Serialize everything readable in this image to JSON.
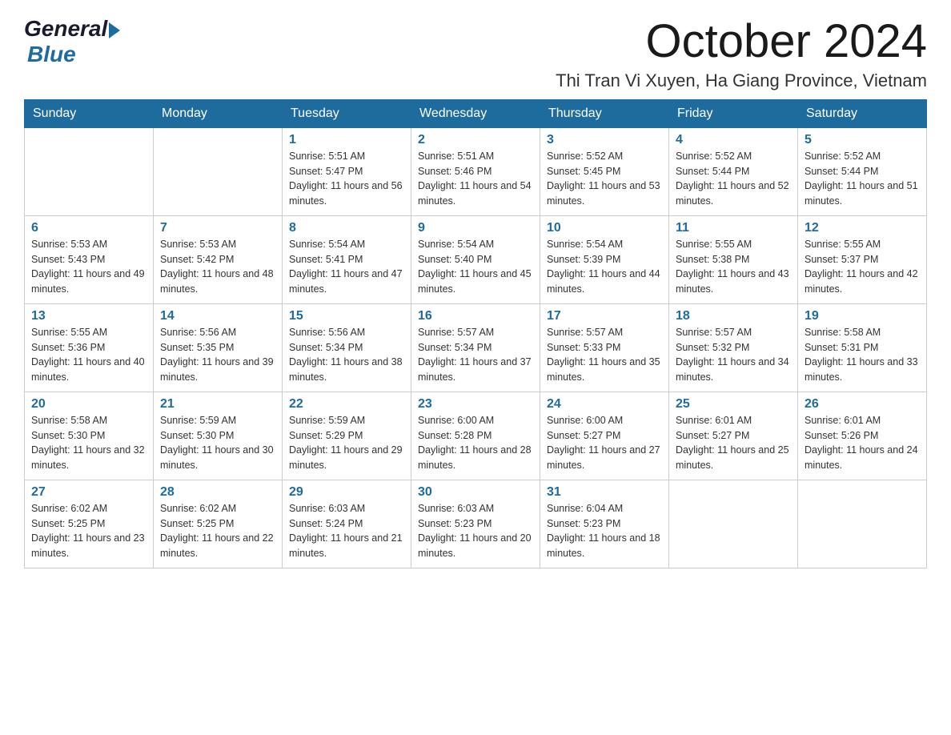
{
  "header": {
    "logo": {
      "general": "General",
      "blue": "Blue"
    },
    "month_title": "October 2024",
    "location": "Thi Tran Vi Xuyen, Ha Giang Province, Vietnam"
  },
  "days_of_week": [
    "Sunday",
    "Monday",
    "Tuesday",
    "Wednesday",
    "Thursday",
    "Friday",
    "Saturday"
  ],
  "weeks": [
    [
      {
        "day": "",
        "sunrise": "",
        "sunset": "",
        "daylight": ""
      },
      {
        "day": "",
        "sunrise": "",
        "sunset": "",
        "daylight": ""
      },
      {
        "day": "1",
        "sunrise": "Sunrise: 5:51 AM",
        "sunset": "Sunset: 5:47 PM",
        "daylight": "Daylight: 11 hours and 56 minutes."
      },
      {
        "day": "2",
        "sunrise": "Sunrise: 5:51 AM",
        "sunset": "Sunset: 5:46 PM",
        "daylight": "Daylight: 11 hours and 54 minutes."
      },
      {
        "day": "3",
        "sunrise": "Sunrise: 5:52 AM",
        "sunset": "Sunset: 5:45 PM",
        "daylight": "Daylight: 11 hours and 53 minutes."
      },
      {
        "day": "4",
        "sunrise": "Sunrise: 5:52 AM",
        "sunset": "Sunset: 5:44 PM",
        "daylight": "Daylight: 11 hours and 52 minutes."
      },
      {
        "day": "5",
        "sunrise": "Sunrise: 5:52 AM",
        "sunset": "Sunset: 5:44 PM",
        "daylight": "Daylight: 11 hours and 51 minutes."
      }
    ],
    [
      {
        "day": "6",
        "sunrise": "Sunrise: 5:53 AM",
        "sunset": "Sunset: 5:43 PM",
        "daylight": "Daylight: 11 hours and 49 minutes."
      },
      {
        "day": "7",
        "sunrise": "Sunrise: 5:53 AM",
        "sunset": "Sunset: 5:42 PM",
        "daylight": "Daylight: 11 hours and 48 minutes."
      },
      {
        "day": "8",
        "sunrise": "Sunrise: 5:54 AM",
        "sunset": "Sunset: 5:41 PM",
        "daylight": "Daylight: 11 hours and 47 minutes."
      },
      {
        "day": "9",
        "sunrise": "Sunrise: 5:54 AM",
        "sunset": "Sunset: 5:40 PM",
        "daylight": "Daylight: 11 hours and 45 minutes."
      },
      {
        "day": "10",
        "sunrise": "Sunrise: 5:54 AM",
        "sunset": "Sunset: 5:39 PM",
        "daylight": "Daylight: 11 hours and 44 minutes."
      },
      {
        "day": "11",
        "sunrise": "Sunrise: 5:55 AM",
        "sunset": "Sunset: 5:38 PM",
        "daylight": "Daylight: 11 hours and 43 minutes."
      },
      {
        "day": "12",
        "sunrise": "Sunrise: 5:55 AM",
        "sunset": "Sunset: 5:37 PM",
        "daylight": "Daylight: 11 hours and 42 minutes."
      }
    ],
    [
      {
        "day": "13",
        "sunrise": "Sunrise: 5:55 AM",
        "sunset": "Sunset: 5:36 PM",
        "daylight": "Daylight: 11 hours and 40 minutes."
      },
      {
        "day": "14",
        "sunrise": "Sunrise: 5:56 AM",
        "sunset": "Sunset: 5:35 PM",
        "daylight": "Daylight: 11 hours and 39 minutes."
      },
      {
        "day": "15",
        "sunrise": "Sunrise: 5:56 AM",
        "sunset": "Sunset: 5:34 PM",
        "daylight": "Daylight: 11 hours and 38 minutes."
      },
      {
        "day": "16",
        "sunrise": "Sunrise: 5:57 AM",
        "sunset": "Sunset: 5:34 PM",
        "daylight": "Daylight: 11 hours and 37 minutes."
      },
      {
        "day": "17",
        "sunrise": "Sunrise: 5:57 AM",
        "sunset": "Sunset: 5:33 PM",
        "daylight": "Daylight: 11 hours and 35 minutes."
      },
      {
        "day": "18",
        "sunrise": "Sunrise: 5:57 AM",
        "sunset": "Sunset: 5:32 PM",
        "daylight": "Daylight: 11 hours and 34 minutes."
      },
      {
        "day": "19",
        "sunrise": "Sunrise: 5:58 AM",
        "sunset": "Sunset: 5:31 PM",
        "daylight": "Daylight: 11 hours and 33 minutes."
      }
    ],
    [
      {
        "day": "20",
        "sunrise": "Sunrise: 5:58 AM",
        "sunset": "Sunset: 5:30 PM",
        "daylight": "Daylight: 11 hours and 32 minutes."
      },
      {
        "day": "21",
        "sunrise": "Sunrise: 5:59 AM",
        "sunset": "Sunset: 5:30 PM",
        "daylight": "Daylight: 11 hours and 30 minutes."
      },
      {
        "day": "22",
        "sunrise": "Sunrise: 5:59 AM",
        "sunset": "Sunset: 5:29 PM",
        "daylight": "Daylight: 11 hours and 29 minutes."
      },
      {
        "day": "23",
        "sunrise": "Sunrise: 6:00 AM",
        "sunset": "Sunset: 5:28 PM",
        "daylight": "Daylight: 11 hours and 28 minutes."
      },
      {
        "day": "24",
        "sunrise": "Sunrise: 6:00 AM",
        "sunset": "Sunset: 5:27 PM",
        "daylight": "Daylight: 11 hours and 27 minutes."
      },
      {
        "day": "25",
        "sunrise": "Sunrise: 6:01 AM",
        "sunset": "Sunset: 5:27 PM",
        "daylight": "Daylight: 11 hours and 25 minutes."
      },
      {
        "day": "26",
        "sunrise": "Sunrise: 6:01 AM",
        "sunset": "Sunset: 5:26 PM",
        "daylight": "Daylight: 11 hours and 24 minutes."
      }
    ],
    [
      {
        "day": "27",
        "sunrise": "Sunrise: 6:02 AM",
        "sunset": "Sunset: 5:25 PM",
        "daylight": "Daylight: 11 hours and 23 minutes."
      },
      {
        "day": "28",
        "sunrise": "Sunrise: 6:02 AM",
        "sunset": "Sunset: 5:25 PM",
        "daylight": "Daylight: 11 hours and 22 minutes."
      },
      {
        "day": "29",
        "sunrise": "Sunrise: 6:03 AM",
        "sunset": "Sunset: 5:24 PM",
        "daylight": "Daylight: 11 hours and 21 minutes."
      },
      {
        "day": "30",
        "sunrise": "Sunrise: 6:03 AM",
        "sunset": "Sunset: 5:23 PM",
        "daylight": "Daylight: 11 hours and 20 minutes."
      },
      {
        "day": "31",
        "sunrise": "Sunrise: 6:04 AM",
        "sunset": "Sunset: 5:23 PM",
        "daylight": "Daylight: 11 hours and 18 minutes."
      },
      {
        "day": "",
        "sunrise": "",
        "sunset": "",
        "daylight": ""
      },
      {
        "day": "",
        "sunrise": "",
        "sunset": "",
        "daylight": ""
      }
    ]
  ]
}
